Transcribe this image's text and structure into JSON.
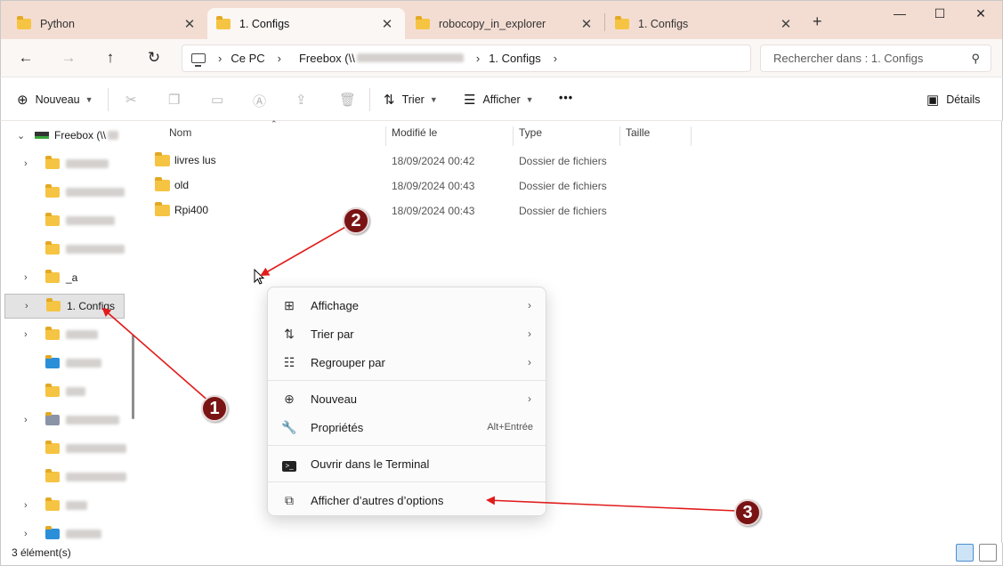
{
  "tabs": [
    {
      "label": "Python",
      "active": false
    },
    {
      "label": "1. Configs",
      "active": true
    },
    {
      "label": "robocopy_in_explorer",
      "active": false
    },
    {
      "label": "1. Configs",
      "active": false
    }
  ],
  "window_controls": {
    "new_tab": "+",
    "minimize": "—",
    "maximize": "☐",
    "close": "✕"
  },
  "address": {
    "crumbs": [
      "Ce PC",
      "Freebox (\\\\",
      "1. Configs"
    ],
    "search_placeholder": "Rechercher dans : 1. Configs"
  },
  "toolbar": {
    "new_label": "Nouveau",
    "sort_label": "Trier",
    "view_label": "Afficher",
    "more_label": "•••",
    "details_label": "Détails"
  },
  "nav": {
    "root_label": "Freebox (\\\\",
    "items": [
      {
        "label": "_a"
      },
      {
        "label": "1. Configs"
      }
    ]
  },
  "columns": {
    "name": "Nom",
    "modified": "Modifié le",
    "type": "Type",
    "size": "Taille"
  },
  "files": [
    {
      "name": "livres lus",
      "modified": "18/09/2024 00:42",
      "type": "Dossier de fichiers"
    },
    {
      "name": "old",
      "modified": "18/09/2024 00:43",
      "type": "Dossier de fichiers"
    },
    {
      "name": "Rpi400",
      "modified": "18/09/2024 00:43",
      "type": "Dossier de fichiers"
    }
  ],
  "status": {
    "count": "3 élément(s)"
  },
  "context_menu": {
    "view": "Affichage",
    "sort_by": "Trier par",
    "group_by": "Regrouper par",
    "new": "Nouveau",
    "properties": "Propriétés",
    "properties_shortcut": "Alt+Entrée",
    "terminal": "Ouvrir dans le Terminal",
    "more_options": "Afficher d’autres d’options"
  },
  "annotations": {
    "badge1": "1",
    "badge2": "2",
    "badge3": "3",
    "color": "#e21b1b"
  }
}
